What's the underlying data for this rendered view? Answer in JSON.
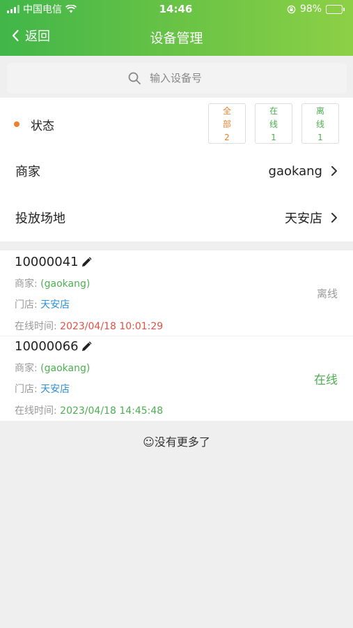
{
  "status_bar": {
    "carrier": "中国电信",
    "time": "14:46",
    "battery": "98%",
    "battery_level": 0.98
  },
  "nav": {
    "back_label": "返回",
    "title": "设备管理"
  },
  "search": {
    "placeholder": "输入设备号"
  },
  "filter": {
    "label": "状态",
    "buttons": [
      {
        "line1": "全",
        "line2": "部",
        "count": "2",
        "color": "#e8822e"
      },
      {
        "line1": "在",
        "line2": "线",
        "count": "1",
        "color": "#4caf50"
      },
      {
        "line1": "离",
        "line2": "线",
        "count": "1",
        "color": "#4caf50"
      }
    ]
  },
  "merchant": {
    "label": "商家",
    "value": "gaokang"
  },
  "venue": {
    "label": "投放场地",
    "value": "天安店"
  },
  "devices": [
    {
      "id": "10000041",
      "merchant_label": "商家:",
      "merchant": "(gaokang)",
      "store_label": "门店:",
      "store": "天安店",
      "time_label": "在线时间:",
      "time": "2023/04/18 10:01:29",
      "status": "离线",
      "status_color": "#999999",
      "time_color": "#e05243"
    },
    {
      "id": "10000066",
      "merchant_label": "商家:",
      "merchant": "(gaokang)",
      "store_label": "门店:",
      "store": "天安店",
      "time_label": "在线时间:",
      "time": "2023/04/18 14:45:48",
      "status": "在线",
      "status_color": "#4caf50",
      "time_color": "#4caf50"
    }
  ],
  "footer": {
    "no_more": "没有更多了"
  }
}
